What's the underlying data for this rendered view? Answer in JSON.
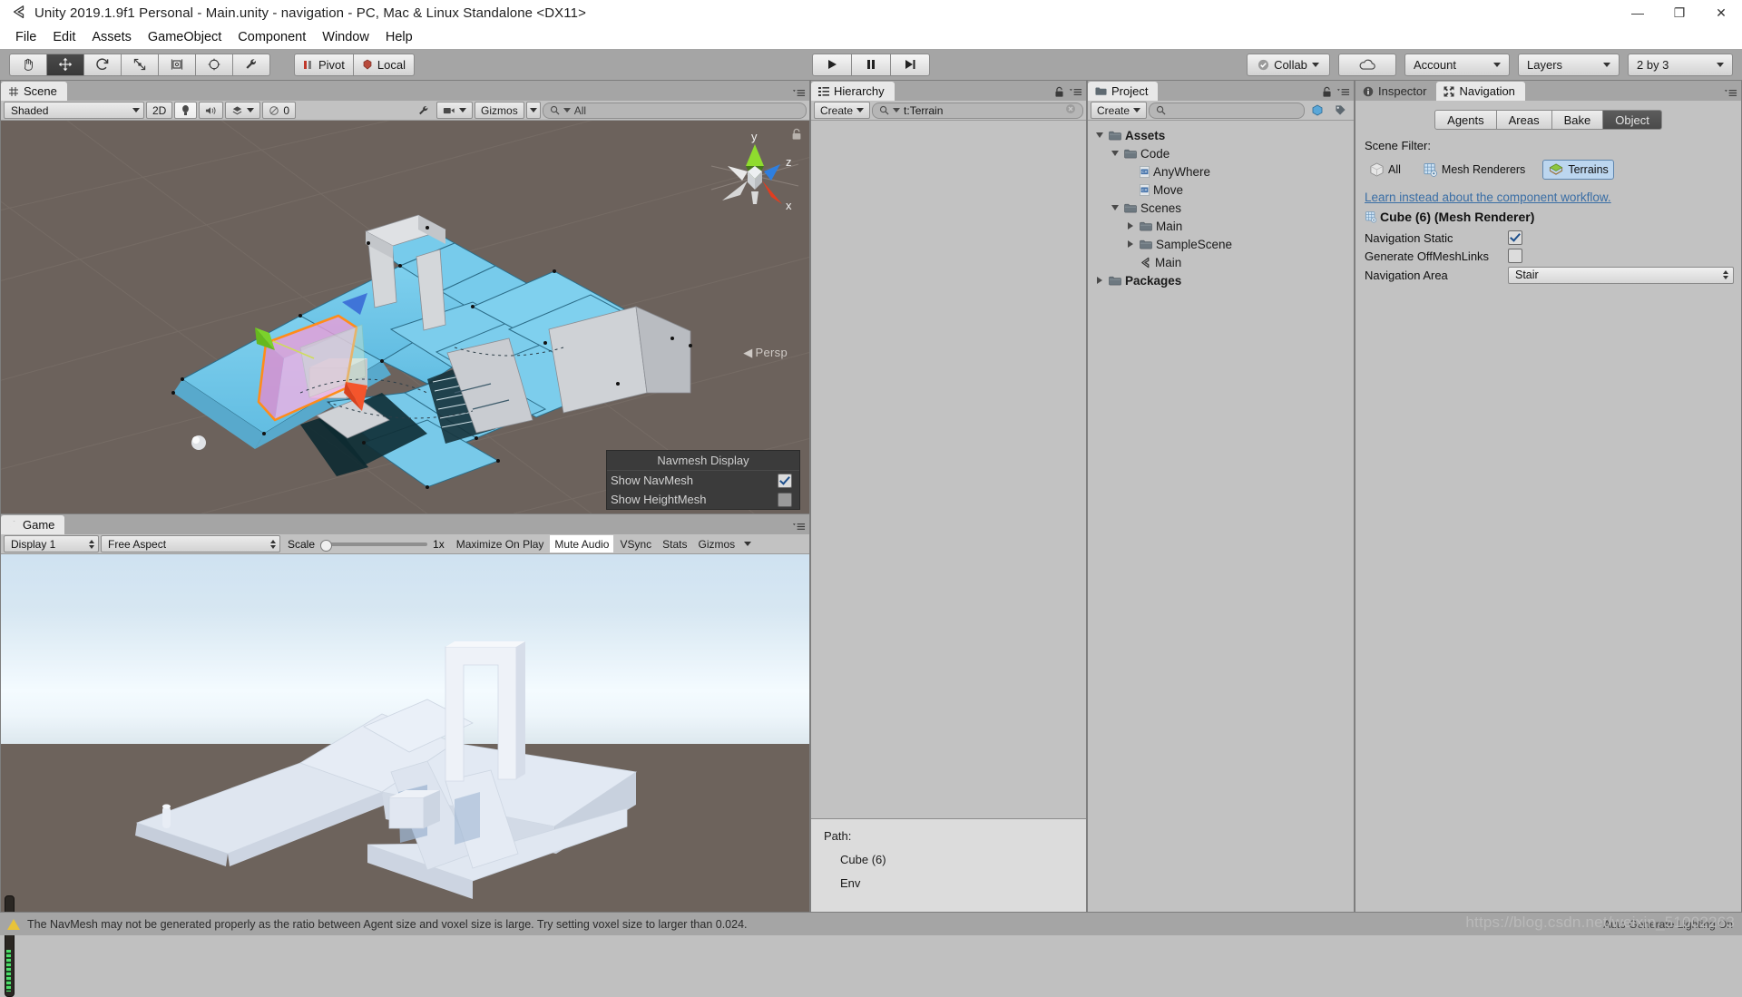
{
  "window": {
    "title": "Unity 2019.1.9f1 Personal - Main.unity - navigation - PC, Mac & Linux Standalone <DX11>",
    "app_icon": "unity-icon",
    "minimize": "—",
    "maximize": "❐",
    "close": "✕"
  },
  "menubar": {
    "items": [
      "File",
      "Edit",
      "Assets",
      "GameObject",
      "Component",
      "Window",
      "Help"
    ]
  },
  "toolbar": {
    "tools": [
      {
        "name": "hand-tool",
        "icon": "hand-icon",
        "active": false
      },
      {
        "name": "move-tool",
        "icon": "move-icon",
        "active": true
      },
      {
        "name": "rotate-tool",
        "icon": "rotate-icon",
        "active": false
      },
      {
        "name": "scale-tool",
        "icon": "scale-icon",
        "active": false
      },
      {
        "name": "rect-tool",
        "icon": "rect-icon",
        "active": false
      },
      {
        "name": "transform-tool",
        "icon": "transform-icon",
        "active": false
      },
      {
        "name": "custom-tool",
        "icon": "wrench-icon",
        "active": false
      }
    ],
    "pivot_label": "Pivot",
    "space_label": "Local",
    "play": "play-icon",
    "pause": "pause-icon",
    "step": "step-icon",
    "collab_label": "Collab",
    "cloud_label": "cloud-icon",
    "account_label": "Account",
    "layers_label": "Layers",
    "layout_label": "2 by 3"
  },
  "scene": {
    "tab_label": "Scene",
    "tab_icon": "scene-grid-icon",
    "shading_mode": "Shaded",
    "mode_2d": "2D",
    "lighting_icon": "lightbulb-icon",
    "audio_icon": "speaker-icon",
    "fx_icon": "fx-icon",
    "hidden_count": "0",
    "tools_icon": "wrench-icon",
    "camera_icon": "camera-icon",
    "gizmos_label": "Gizmos",
    "search_placeholder": "All",
    "search_value": "",
    "axis_labels": {
      "x": "x",
      "y": "y",
      "z": "z"
    },
    "projection_label": "Persp",
    "navmesh_popup": {
      "title": "Navmesh Display",
      "rows": [
        {
          "label": "Show NavMesh",
          "checked": true
        },
        {
          "label": "Show HeightMesh",
          "checked": false
        }
      ]
    }
  },
  "game": {
    "tab_label": "Game",
    "tab_icon": "game-icon",
    "display": "Display 1",
    "aspect": "Free Aspect",
    "scale_label": "Scale",
    "scale_value": "1x",
    "maximize_on_play": "Maximize On Play",
    "mute_audio": "Mute Audio",
    "vsync": "VSync",
    "stats": "Stats",
    "gizmos": "Gizmos"
  },
  "hierarchy": {
    "tab_label": "Hierarchy",
    "tab_icon": "hierarchy-icon",
    "create_label": "Create",
    "search_value": "t:Terrain",
    "items": [],
    "path": {
      "title": "Path:",
      "entries": [
        "Cube (6)",
        "Env"
      ]
    }
  },
  "project": {
    "tab_label": "Project",
    "tab_icon": "folder-icon",
    "create_label": "Create",
    "search_value": "",
    "tree": [
      {
        "label": "Assets",
        "indent": 0,
        "twisty": "down",
        "icon": "folder-icon",
        "bold": true,
        "selected": false
      },
      {
        "label": "Code",
        "indent": 1,
        "twisty": "down",
        "icon": "folder-icon",
        "bold": false,
        "selected": false
      },
      {
        "label": "AnyWhere",
        "indent": 2,
        "twisty": "none",
        "icon": "csharp-icon",
        "bold": false,
        "selected": false
      },
      {
        "label": "Move",
        "indent": 2,
        "twisty": "none",
        "icon": "csharp-icon",
        "bold": false,
        "selected": false
      },
      {
        "label": "Scenes",
        "indent": 1,
        "twisty": "down",
        "icon": "folder-icon",
        "bold": false,
        "selected": false
      },
      {
        "label": "Main",
        "indent": 2,
        "twisty": "right",
        "icon": "folder-icon",
        "bold": false,
        "selected": false
      },
      {
        "label": "SampleScene",
        "indent": 2,
        "twisty": "right",
        "icon": "folder-icon",
        "bold": false,
        "selected": false
      },
      {
        "label": "Main",
        "indent": 2,
        "twisty": "none",
        "icon": "unity-icon",
        "bold": false,
        "selected": false
      },
      {
        "label": "Packages",
        "indent": 0,
        "twisty": "right",
        "icon": "folder-icon",
        "bold": true,
        "selected": false
      }
    ]
  },
  "inspector": {
    "tabs": [
      {
        "label": "Inspector",
        "icon": "info-icon",
        "active": false
      },
      {
        "label": "Navigation",
        "icon": "navigation-icon",
        "active": true
      }
    ],
    "segments": [
      {
        "label": "Agents",
        "active": false
      },
      {
        "label": "Areas",
        "active": false
      },
      {
        "label": "Bake",
        "active": false
      },
      {
        "label": "Object",
        "active": true
      }
    ],
    "scene_filter_label": "Scene Filter:",
    "filters": [
      {
        "label": "All",
        "icon": "cube-icon",
        "active": false
      },
      {
        "label": "Mesh Renderers",
        "icon": "mesh-renderer-icon",
        "active": false
      },
      {
        "label": "Terrains",
        "icon": "terrain-icon",
        "active": true
      }
    ],
    "learn_link": "Learn instead about the component workflow.",
    "object_header": "Cube (6) (Mesh Renderer)",
    "object_icon": "mesh-renderer-icon",
    "properties": [
      {
        "name": "Navigation Static",
        "type": "checkbox",
        "value": true
      },
      {
        "name": "Generate OffMeshLinks",
        "type": "checkbox",
        "value": false
      },
      {
        "name": "Navigation Area",
        "type": "select",
        "value": "Stair"
      }
    ]
  },
  "statusbar": {
    "warning_icon": "warning-icon",
    "message": "The NavMesh may not be generated properly as the ratio between Agent size and voxel size is large. Try setting voxel size to larger than 0.024.",
    "right_text": "Auto Generate Lighting On"
  },
  "watermark": "https://blog.csdn.net/weixin_51002263",
  "colors": {
    "accent_blue": "#6ec6e8",
    "selection_orange": "#ff8c1a",
    "navmesh_cyan": "#6ec6e8",
    "link_blue": "#3a6ea5",
    "warning_yellow": "#e8c33a",
    "chrome_gray": "#a5a5a5",
    "panel_gray": "#c2c2c2",
    "scene_bg": "#6c625c"
  }
}
